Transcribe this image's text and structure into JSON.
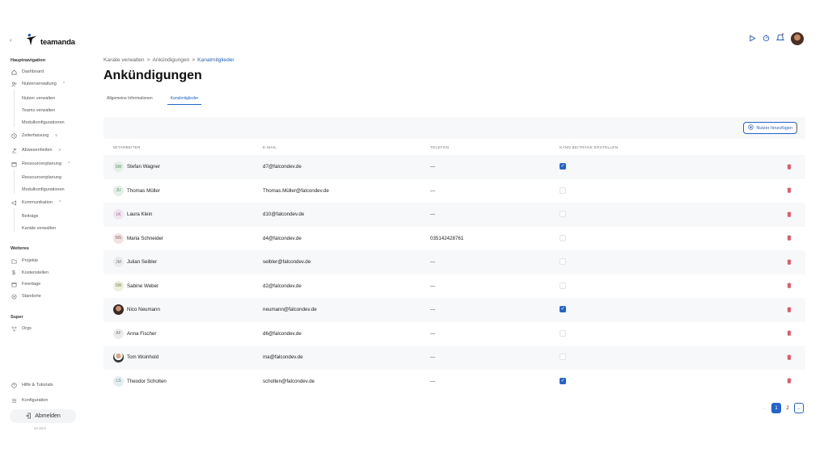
{
  "colors": {
    "accent": "#2563c9",
    "delete": "#e05a6a",
    "row_alt": "#f7f8fa"
  },
  "brand": {
    "name": "teamanda"
  },
  "sidebar": {
    "main_nav_title": "Hauptnavigation",
    "dashboard": "Dashboard",
    "user_mgmt": "Nutzerverwaltung",
    "user_mgmt_sub": [
      "Nutzer verwalten",
      "Teams verwalten",
      "Modulkonfigurationen"
    ],
    "time_tracking": "Zeiterfassung",
    "absences": "Abwesenheiten",
    "resource_planning": "Ressourcenplanung",
    "resource_planning_sub": [
      "Ressourcenplanung",
      "Modulkonfigurationen"
    ],
    "communication": "Kommunikation",
    "communication_sub": [
      "Beiträge",
      "Kanäle verwalten"
    ],
    "more_title": "Weiteres",
    "projects": "Projekte",
    "cost_centers": "Kostenstellen",
    "holidays": "Feiertage",
    "locations": "Standorte",
    "super_title": "Super",
    "orgs": "Orgs",
    "help": "Hilfe & Tutorials",
    "config": "Konfiguration",
    "logout": "Abmelden",
    "version": "v2.10.0"
  },
  "breadcrumb": {
    "item1": "Kanäle verwalten",
    "item2": "Ankündigungen",
    "current": "Kanalmitglieder",
    "sep": ">"
  },
  "page_title": "Ankündigungen",
  "tabs": {
    "general": "Allgemeine Informationen",
    "members": "Kanalmitglieder"
  },
  "add_user_label": "Nutzer hinzufügen",
  "columns": {
    "member": "MITARBEITER",
    "email": "E-MAIL",
    "phone": "TELEFON",
    "can_post": "KANN BEITRÄGE ERSTELLEN"
  },
  "members": [
    {
      "initials": "SW",
      "name": "Stefan Wagner",
      "email": "d7@falcondev.de",
      "phone": "---",
      "can_post": true,
      "avatar": "initials",
      "av_bg": "#e3f0e6",
      "av_fg": "#5a8a66"
    },
    {
      "initials": "JU",
      "name": "Thomas Müller",
      "email": "Thomas.Müller@falcondev.de",
      "phone": "---",
      "can_post": false,
      "avatar": "initials",
      "av_bg": "#e5efe8",
      "av_fg": "#5a8a66"
    },
    {
      "initials": "LK",
      "name": "Laura Klein",
      "email": "d10@falcondev.de",
      "phone": "---",
      "can_post": false,
      "avatar": "initials",
      "av_bg": "#f1e5ef",
      "av_fg": "#946080"
    },
    {
      "initials": "MS",
      "name": "Maria Schneider",
      "email": "d4@falcondev.de",
      "phone": "035142428761",
      "can_post": false,
      "avatar": "initials",
      "av_bg": "#f1e3e3",
      "av_fg": "#946060"
    },
    {
      "initials": "JM",
      "name": "Julian Seibler",
      "email": "seibler@falcondev.de",
      "phone": "---",
      "can_post": false,
      "avatar": "initials",
      "av_bg": "#ececec",
      "av_fg": "#777777"
    },
    {
      "initials": "SW",
      "name": "Sabine Weber",
      "email": "d2@falcondev.de",
      "phone": "---",
      "can_post": false,
      "avatar": "initials",
      "av_bg": "#eef0dc",
      "av_fg": "#7a8050"
    },
    {
      "initials": "",
      "name": "Nico Neumann",
      "email": "neumann@falcondev.de",
      "phone": "---",
      "can_post": true,
      "avatar": "photo1",
      "av_bg": "",
      "av_fg": ""
    },
    {
      "initials": "AF",
      "name": "Anna Fischer",
      "email": "d6@falcondev.de",
      "phone": "---",
      "can_post": false,
      "avatar": "initials",
      "av_bg": "#ececec",
      "av_fg": "#777777"
    },
    {
      "initials": "",
      "name": "Tom Woinhold",
      "email": "ma@falcondev.de",
      "phone": "---",
      "can_post": false,
      "avatar": "photo2",
      "av_bg": "",
      "av_fg": ""
    },
    {
      "initials": "LS",
      "name": "Theodor Scholten",
      "email": "scholten@falcondev.de",
      "phone": "---",
      "can_post": true,
      "avatar": "initials",
      "av_bg": "#e3eef0",
      "av_fg": "#5a8088"
    }
  ],
  "pagination": {
    "prev": "←",
    "pages": [
      "1",
      "2"
    ],
    "current": "1",
    "next": "→"
  }
}
